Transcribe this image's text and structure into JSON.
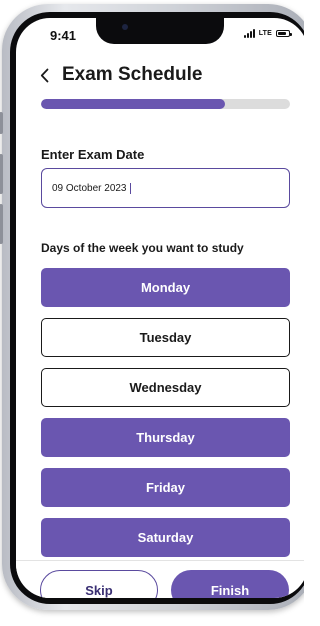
{
  "status_bar": {
    "time": "9:41",
    "network": "LTE",
    "icons": [
      "signal-bars-icon",
      "battery-icon"
    ]
  },
  "header": {
    "back_icon": "chevron-left-icon",
    "title": "Exam Schedule"
  },
  "progress": {
    "value_fraction": 0.74
  },
  "exam_date": {
    "label": "Enter Exam Date",
    "value": "09 October 2023"
  },
  "days": {
    "label": "Days of the week you want to study",
    "items": [
      {
        "label": "Monday",
        "selected": true
      },
      {
        "label": "Tuesday",
        "selected": false
      },
      {
        "label": "Wednesday",
        "selected": false
      },
      {
        "label": "Thursday",
        "selected": true
      },
      {
        "label": "Friday",
        "selected": true
      },
      {
        "label": "Saturday",
        "selected": true
      }
    ]
  },
  "footer": {
    "skip_label": "Skip",
    "finish_label": "Finish"
  },
  "colors": {
    "accent": "#6a56b0",
    "accent_dark": "#3a2f73",
    "track": "#dcdcdc"
  }
}
